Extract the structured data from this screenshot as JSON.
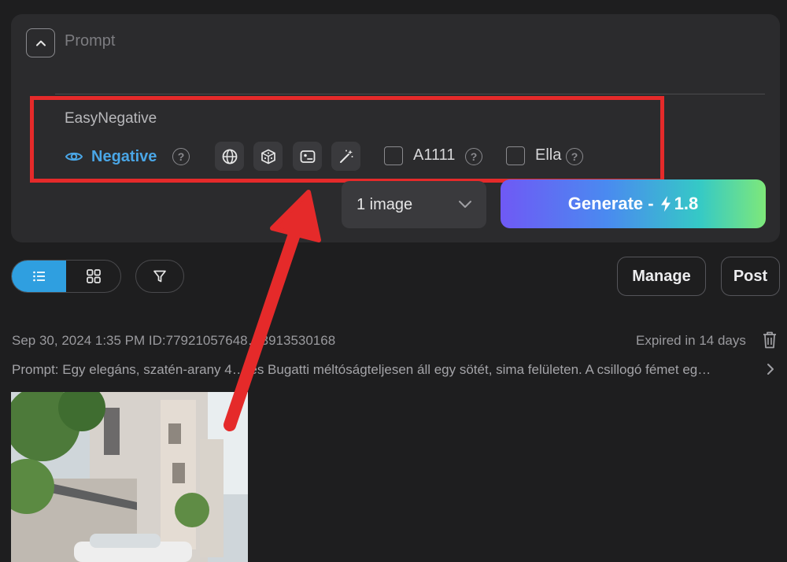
{
  "prompt": {
    "placeholder": "Prompt",
    "negative_text": "EasyNegative",
    "negative_label": "Negative",
    "options": [
      {
        "label": "A1111",
        "checked": false
      },
      {
        "label": "Ella",
        "checked": false
      }
    ],
    "tools": [
      "globe-icon",
      "dice-icon",
      "image-icon",
      "magic-wand-icon"
    ]
  },
  "controls": {
    "image_count": "1 image",
    "generate_label": "Generate -",
    "generate_cost": "1.8"
  },
  "toolbar": {
    "manage_label": "Manage",
    "post_label": "Post"
  },
  "history": {
    "meta": "Sep 30, 2024 1:35 PM ID:77921057648…3913530168",
    "expired": "Expired in 14 days",
    "prompt": "Prompt: Egy elegáns, szatén-arany 4…-es Bugatti méltóságteljesen áll egy sötét, sima felületen. A csillogó fémet eg…"
  },
  "colors": {
    "accent": "#2f9fe0",
    "negative": "#4aa6e6",
    "highlight": "#e52a2a",
    "background": "#1e1e1f",
    "panel": "#2b2b2d"
  }
}
